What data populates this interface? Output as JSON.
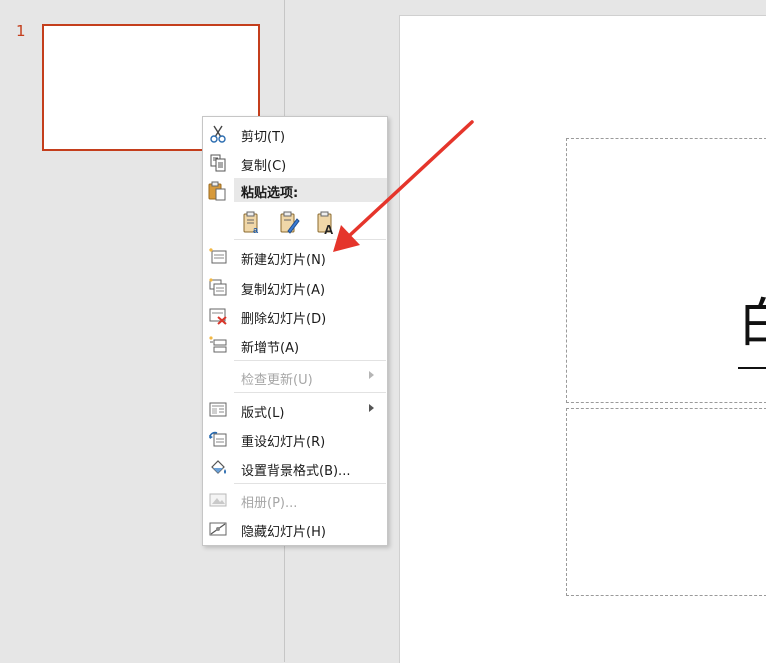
{
  "thumbnail_pane": {
    "slide_number": "1"
  },
  "slide": {
    "title_text": "白"
  },
  "context_menu": {
    "cut": "剪切(T)",
    "copy": "复制(C)",
    "paste_header": "粘贴选项:",
    "new_slide": "新建幻灯片(N)",
    "duplicate_slide": "复制幻灯片(A)",
    "delete_slide": "删除幻灯片(D)",
    "add_section": "新增节(A)",
    "check_updates": "检查更新(U)",
    "layout": "版式(L)",
    "reset_slide": "重设幻灯片(R)",
    "format_background": "设置背景格式(B)...",
    "photo_album": "相册(P)...",
    "hide_slide": "隐藏幻灯片(H)"
  },
  "colors": {
    "accent": "#c43e1c",
    "annotation_arrow": "#e5352b"
  }
}
